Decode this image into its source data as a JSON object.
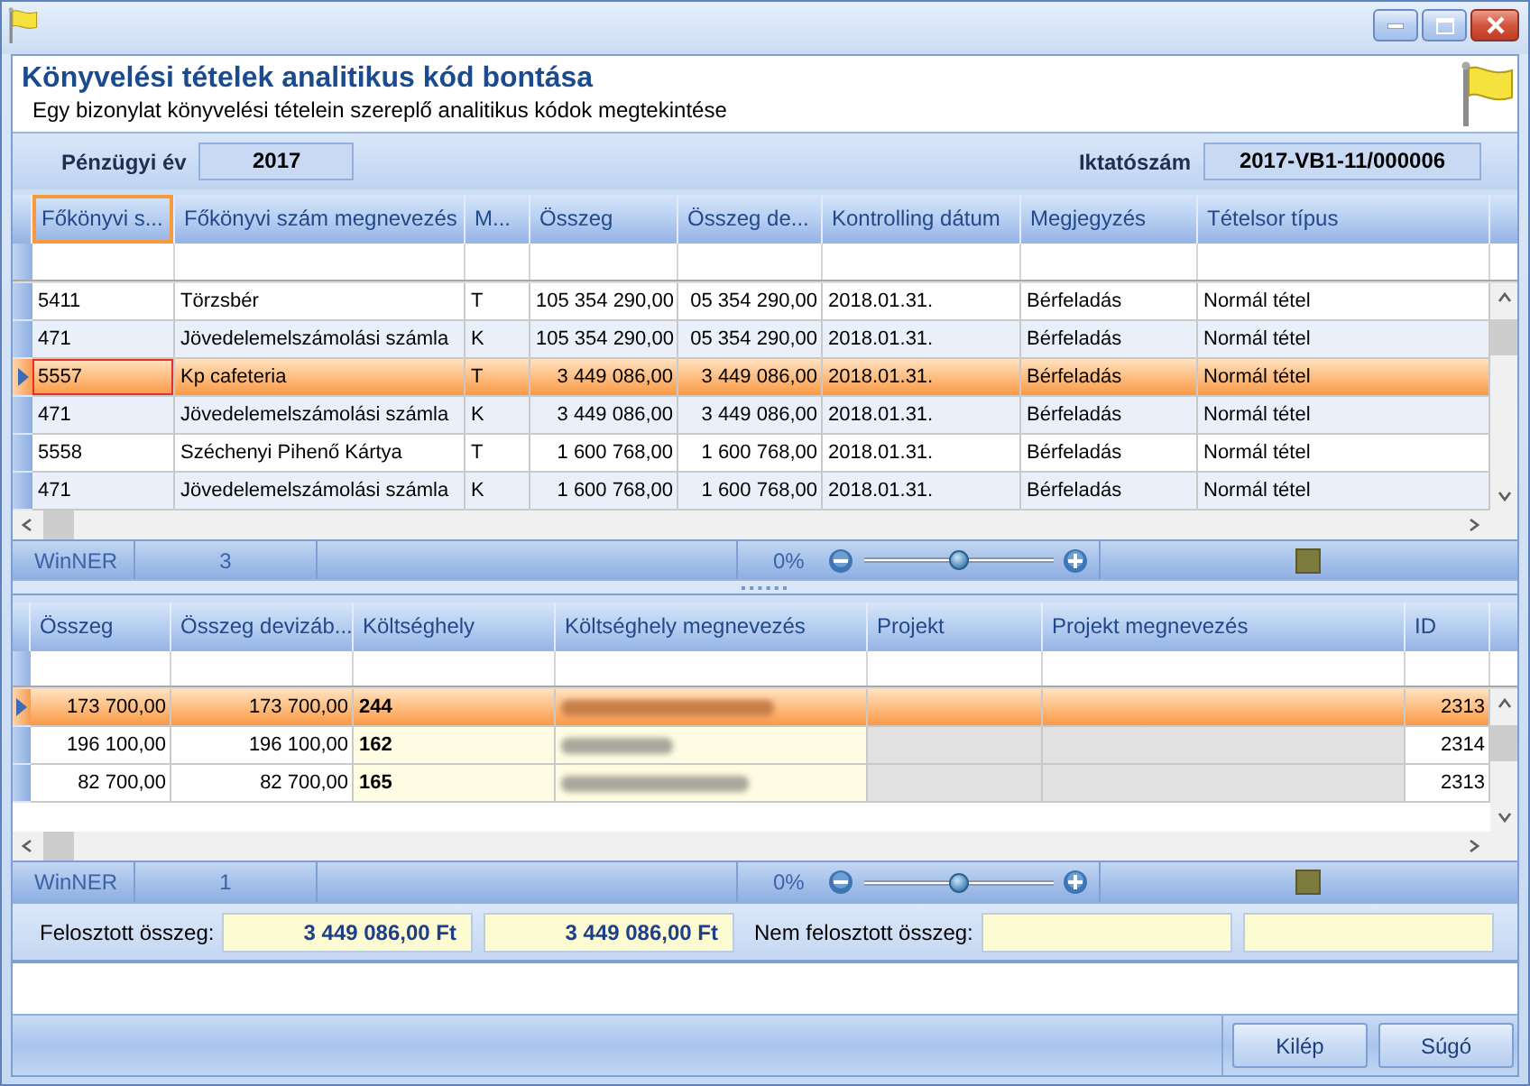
{
  "header": {
    "title": "Könyvelési tételek analitikus kód bontása",
    "subtitle": "Egy bizonylat könyvelési tételein szereplő analitikus kódok megtekintése"
  },
  "info": {
    "fiscal_year_label": "Pénzügyi év",
    "fiscal_year": "2017",
    "document_number_label": "Iktatószám",
    "document_number": "2017-VB1-11/000006"
  },
  "upper_grid": {
    "striped": true,
    "columns": [
      {
        "label": "Főkönyvi s...",
        "kind": "text",
        "focused": true
      },
      {
        "label": "Főkönyvi szám megnevezés",
        "kind": "text",
        "focused": false
      },
      {
        "label": "M...",
        "kind": "text",
        "focused": false
      },
      {
        "label": "Összeg",
        "kind": "number",
        "focused": false
      },
      {
        "label": "Összeg de...",
        "kind": "number",
        "focused": false
      },
      {
        "label": "Kontrolling dátum",
        "kind": "text",
        "focused": false
      },
      {
        "label": "Megjegyzés",
        "kind": "text",
        "focused": false
      },
      {
        "label": "Tételsor típus",
        "kind": "text",
        "focused": false
      }
    ],
    "rows": [
      {
        "selected": false,
        "cells": [
          "5411",
          "Törzsbér",
          "T",
          "105 354 290,00",
          "05 354 290,00",
          "2018.01.31.",
          "Bérfeladás",
          "Normál tétel"
        ]
      },
      {
        "selected": false,
        "cells": [
          "471",
          "Jövedelemelszámolási számla",
          "K",
          "105 354 290,00",
          "05 354 290,00",
          "2018.01.31.",
          "Bérfeladás",
          "Normál tétel"
        ]
      },
      {
        "selected": true,
        "cells": [
          "5557",
          "Kp cafeteria",
          "T",
          "3 449 086,00",
          "3 449 086,00",
          "2018.01.31.",
          "Bérfeladás",
          "Normál tétel"
        ]
      },
      {
        "selected": false,
        "cells": [
          "471",
          "Jövedelemelszámolási számla",
          "K",
          "3 449 086,00",
          "3 449 086,00",
          "2018.01.31.",
          "Bérfeladás",
          "Normál tétel"
        ]
      },
      {
        "selected": false,
        "cells": [
          "5558",
          "Széchenyi Pihenő Kártya",
          "T",
          "1 600 768,00",
          "1 600 768,00",
          "2018.01.31.",
          "Bérfeladás",
          "Normál tétel"
        ]
      },
      {
        "selected": false,
        "cells": [
          "471",
          "Jövedelemelszámolási számla",
          "K",
          "1 600 768,00",
          "1 600 768,00",
          "2018.01.31.",
          "Bérfeladás",
          "Normál tétel"
        ]
      }
    ]
  },
  "upper_status": {
    "source": "WinNER",
    "count": "3",
    "zoom_reading": "0%",
    "zoom": {
      "level": 0.5
    }
  },
  "lower_grid": {
    "striped": false,
    "columns": [
      {
        "label": "Összeg",
        "kind": "number",
        "focused": false
      },
      {
        "label": "Összeg devizáb...",
        "kind": "number",
        "focused": false
      },
      {
        "label": "Költséghely",
        "kind": "key",
        "focused": false
      },
      {
        "label": "Költséghely megnevezés",
        "kind": "lookup",
        "focused": false
      },
      {
        "label": "Projekt",
        "kind": "locked",
        "focused": false
      },
      {
        "label": "Projekt megnevezés",
        "kind": "locked",
        "focused": false
      },
      {
        "label": "ID",
        "kind": "number",
        "focused": false
      }
    ],
    "rows": [
      {
        "selected": true,
        "amount": "173 700,00",
        "amount_2": "173 700,00",
        "cost_center": "244",
        "cost_center_name_blurred": true,
        "id": "2313"
      },
      {
        "selected": false,
        "amount": "196 100,00",
        "amount_2": "196 100,00",
        "cost_center": "162",
        "cost_center_name_blurred": true,
        "id": "2314"
      },
      {
        "selected": false,
        "amount": "82 700,00",
        "amount_2": "82 700,00",
        "cost_center": "165",
        "cost_center_name_blurred": true,
        "id": "2313"
      }
    ]
  },
  "lower_status": {
    "source": "WinNER",
    "count": "1",
    "zoom_reading": "0%",
    "zoom": {
      "level": 0.5
    }
  },
  "summary": {
    "allocated_label": "Felosztott összeg:",
    "allocated_values": [
      "3 449 086,00 Ft",
      "3 449 086,00 Ft"
    ],
    "unallocated_label": "Nem felosztott összeg:"
  },
  "buttons": [
    {
      "label": "Kilép"
    },
    {
      "label": "Súgó"
    }
  ]
}
